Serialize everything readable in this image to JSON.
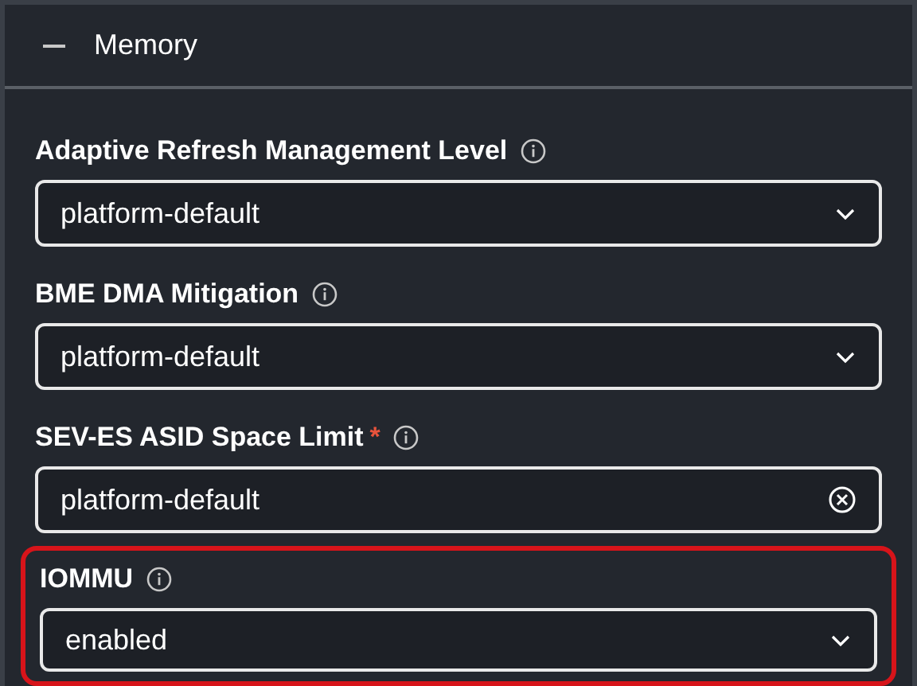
{
  "section": {
    "title": "Memory",
    "expanded": true
  },
  "fields": [
    {
      "label": "Adaptive Refresh Management Level",
      "kind": "select",
      "value": "platform-default",
      "highlighted": false
    },
    {
      "label": "BME DMA Mitigation",
      "kind": "select",
      "value": "platform-default",
      "highlighted": false
    },
    {
      "label": "SEV-ES ASID Space Limit",
      "required_mark": "*",
      "kind": "clearable",
      "value": "platform-default",
      "highlighted": false
    },
    {
      "label": "IOMMU",
      "kind": "select",
      "value": "enabled",
      "highlighted": true
    }
  ]
}
